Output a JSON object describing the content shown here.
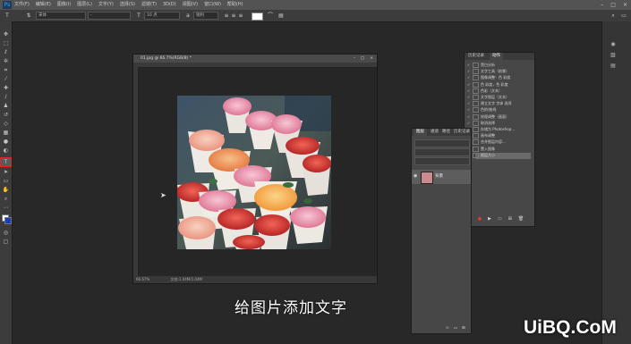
{
  "menubar": {
    "items": [
      "文件(F)",
      "编辑(E)",
      "图像(I)",
      "图层(L)",
      "文字(Y)",
      "选择(S)",
      "滤镜(T)",
      "3D(D)",
      "视图(V)",
      "窗口(W)",
      "帮助(H)"
    ],
    "logo": "Ps"
  },
  "optionsbar": {
    "tool_icon": "T",
    "font_family": "宋体",
    "font_style": "-",
    "font_size": "10 点",
    "aa_mode": "锐利",
    "color_swatch": "#ffffff"
  },
  "document": {
    "tab_title": "01.jpg @ 66.7%(RGB/8) *",
    "zoom": "66.67%",
    "doc_info": "文档:1.04M/1.04M"
  },
  "history_panel": {
    "tabs": [
      "历史记录",
      "动作"
    ],
    "items": [
      "黑白分析",
      "文字工具（前景）",
      "图像调整：色 彩度",
      "色 彩度，色 彩度",
      "色彩（文本）",
      "文字图层（文本）",
      "建立文字 字体 选项",
      "色阶/曲线",
      "纹理调整（画面）",
      "取消选择",
      "存储为 Photoshop...",
      "画布调整",
      "合并图层内容...",
      "置入图像",
      "图层大小"
    ]
  },
  "layers_panel": {
    "tabs": [
      "图层",
      "通道",
      "路径",
      "历史记录"
    ],
    "layer_name": "背景"
  },
  "subtitle": "给图片添加文字",
  "watermark": "UiBQ.CoM"
}
